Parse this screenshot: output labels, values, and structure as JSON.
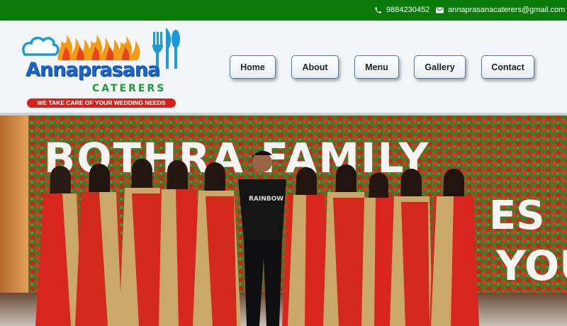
{
  "topbar": {
    "phone": "9884230452",
    "email": "annaprasanacaterers@gmail.com",
    "phone_icon": "phone-icon",
    "email_icon": "envelope-icon"
  },
  "logo": {
    "name": "Annaprasana",
    "subtitle": "CATERERS",
    "tagline": "WE TAKE CARE OF YOUR WEDDING NEEDS",
    "icons": [
      "chef-hat-icon",
      "flames-icon",
      "cutlery-icon"
    ]
  },
  "nav": {
    "items": [
      "Home",
      "About",
      "Menu",
      "Gallery",
      "Contact"
    ]
  },
  "banner": {
    "line1": "BOTHRA FAMILY",
    "line2_part": "ES",
    "line3_part": "YOU",
    "shirt_text": "RAINBOW"
  },
  "colors": {
    "topbar_bg": "#0a7a0a",
    "header_bg": "#f3f6f8",
    "logo_blue": "#1a64c8",
    "logo_green": "#1e9a3a",
    "logo_red": "#d6201a",
    "saree_red": "#d8261e"
  }
}
